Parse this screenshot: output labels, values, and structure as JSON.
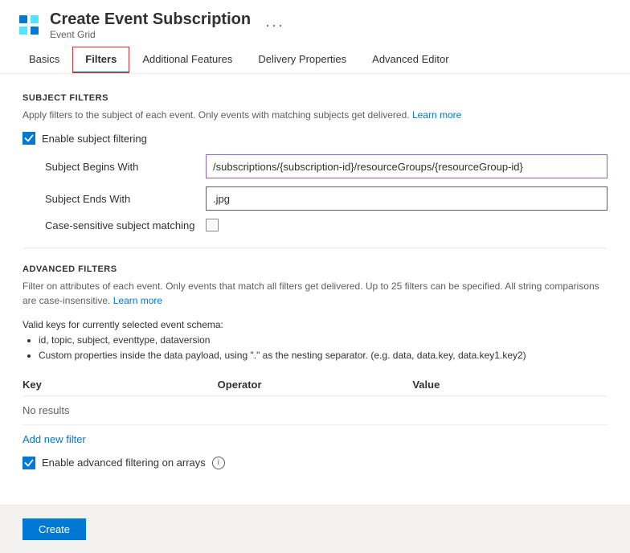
{
  "header": {
    "title": "Create Event Subscription",
    "subtitle": "Event Grid",
    "more_icon": "···"
  },
  "tabs": [
    {
      "id": "basics",
      "label": "Basics",
      "active": false
    },
    {
      "id": "filters",
      "label": "Filters",
      "active": true
    },
    {
      "id": "additional-features",
      "label": "Additional Features",
      "active": false
    },
    {
      "id": "delivery-properties",
      "label": "Delivery Properties",
      "active": false
    },
    {
      "id": "advanced-editor",
      "label": "Advanced Editor",
      "active": false
    }
  ],
  "subject_filters": {
    "section_title": "SUBJECT FILTERS",
    "description": "Apply filters to the subject of each event. Only events with matching subjects get delivered.",
    "learn_more": "Learn more",
    "enable_checkbox_label": "Enable subject filtering",
    "enable_checked": true,
    "subject_begins_with_label": "Subject Begins With",
    "subject_begins_with_value": "/subscriptions/{subscription-id}/resourceGroups/{resourceGroup-id}",
    "subject_ends_with_label": "Subject Ends With",
    "subject_ends_with_value": ".jpg",
    "case_sensitive_label": "Case-sensitive subject matching",
    "case_sensitive_checked": false
  },
  "advanced_filters": {
    "section_title": "ADVANCED FILTERS",
    "description": "Filter on attributes of each event. Only events that match all filters get delivered. Up to 25 filters can be specified. All string comparisons are case-insensitive.",
    "learn_more": "Learn more",
    "valid_keys_intro": "Valid keys for currently selected event schema:",
    "valid_keys_list": [
      "id, topic, subject, eventtype, dataversion",
      "Custom properties inside the data payload, using \".\" as the nesting separator. (e.g. data, data.key, data.key1.key2)"
    ],
    "table_columns": [
      "Key",
      "Operator",
      "Value"
    ],
    "table_no_results": "No results",
    "add_filter_label": "Add new filter",
    "enable_advanced_label": "Enable advanced filtering on arrays",
    "enable_advanced_checked": true
  },
  "footer": {
    "create_button_label": "Create"
  }
}
